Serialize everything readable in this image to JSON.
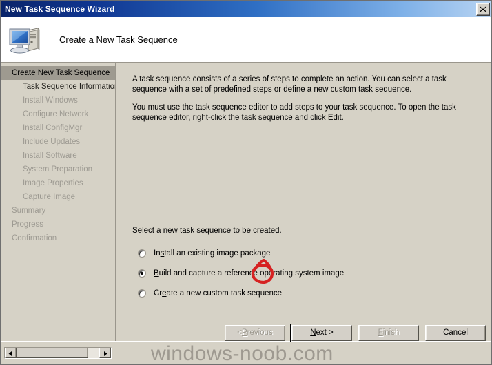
{
  "window": {
    "title": "New Task Sequence Wizard",
    "close_icon": "close-icon"
  },
  "header": {
    "title": "Create a New Task Sequence",
    "icon": "computer-icon"
  },
  "sidebar": {
    "items": [
      {
        "label": "Create New Task Sequence",
        "state": "selected",
        "indent": false
      },
      {
        "label": "Task Sequence Information",
        "state": "active",
        "indent": true
      },
      {
        "label": "Install Windows",
        "state": "disabled",
        "indent": true
      },
      {
        "label": "Configure Network",
        "state": "disabled",
        "indent": true
      },
      {
        "label": "Install ConfigMgr",
        "state": "disabled",
        "indent": true
      },
      {
        "label": "Include Updates",
        "state": "disabled",
        "indent": true
      },
      {
        "label": "Install Software",
        "state": "disabled",
        "indent": true
      },
      {
        "label": "System Preparation",
        "state": "disabled",
        "indent": true
      },
      {
        "label": "Image Properties",
        "state": "disabled",
        "indent": true
      },
      {
        "label": "Capture Image",
        "state": "disabled",
        "indent": true
      },
      {
        "label": "Summary",
        "state": "disabled",
        "indent": false
      },
      {
        "label": "Progress",
        "state": "disabled",
        "indent": false
      },
      {
        "label": "Confirmation",
        "state": "disabled",
        "indent": false
      }
    ]
  },
  "main": {
    "paragraph1": "A task sequence consists of a series of steps to complete an action. You can select a task sequence with a set of predefined steps or define a new custom task sequence.",
    "paragraph2": "You must use the task sequence editor to add steps to your task sequence. To open the task sequence editor, right-click the task sequence and click Edit.",
    "select_label": "Select a new task sequence to be created.",
    "options": [
      {
        "label": "Install an existing image package",
        "accel_index": 2,
        "checked": false
      },
      {
        "label": "Build and capture a reference operating system image",
        "accel_index": 0,
        "checked": true
      },
      {
        "label": "Create a new custom task sequence",
        "accel_index": 2,
        "checked": false
      }
    ]
  },
  "annotation": {
    "type": "hand-drawn-circle",
    "color": "#d62222",
    "target": "option-build-and-capture"
  },
  "footer": {
    "buttons": [
      {
        "label": "< Previous",
        "accel_index": 2,
        "state": "disabled",
        "default": false
      },
      {
        "label": "Next >",
        "accel_index": 0,
        "state": "enabled",
        "default": true
      },
      {
        "label": "Finish",
        "accel_index": 0,
        "state": "disabled",
        "default": false
      },
      {
        "label": "Cancel",
        "accel_index": -1,
        "state": "enabled",
        "default": false
      }
    ],
    "scrollbar": {
      "left_arrow_icon": "triangle-left-icon",
      "right_arrow_icon": "triangle-right-icon"
    }
  },
  "watermark": {
    "text": "windows-noob.com"
  }
}
